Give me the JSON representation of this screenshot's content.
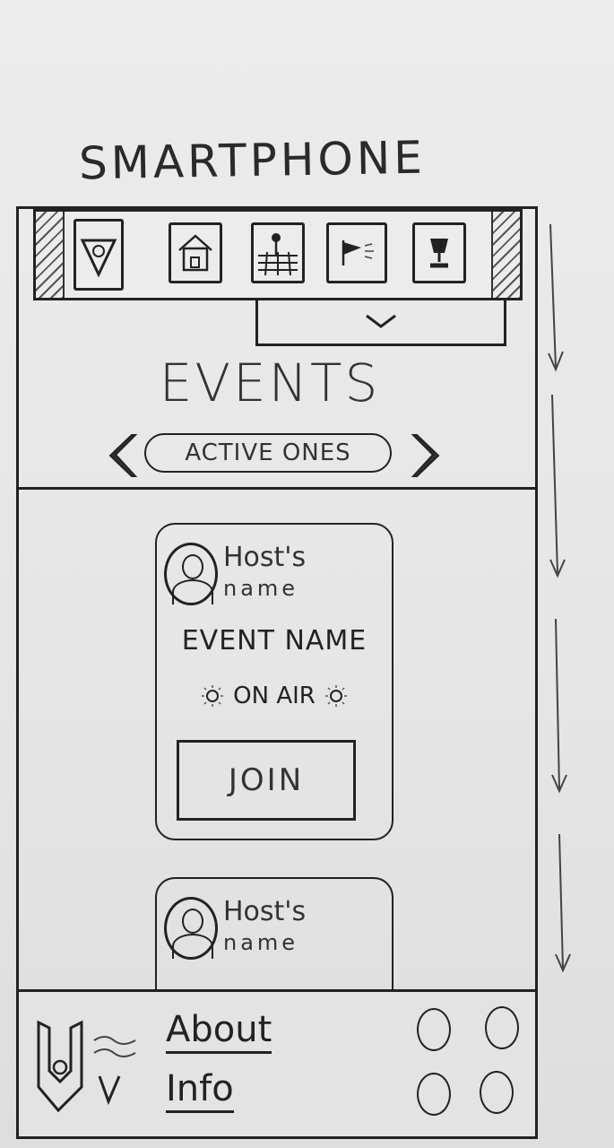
{
  "header": {
    "title": "SMARTPHONE"
  },
  "nav": {
    "icons": [
      "eye-triangle-icon",
      "house-icon",
      "map-icon",
      "flag-icon",
      "trophy-icon"
    ]
  },
  "page": {
    "title": "EVENTS",
    "filter_label": "ACTIVE ONES"
  },
  "events": [
    {
      "host_line1": "Host's",
      "host_line2": "name",
      "event_name": "EVENT NAME",
      "status": "ON AIR",
      "action": "JOIN"
    },
    {
      "host_line1": "Host's",
      "host_line2": "name"
    }
  ],
  "footer": {
    "links": [
      "About",
      "Info"
    ]
  }
}
